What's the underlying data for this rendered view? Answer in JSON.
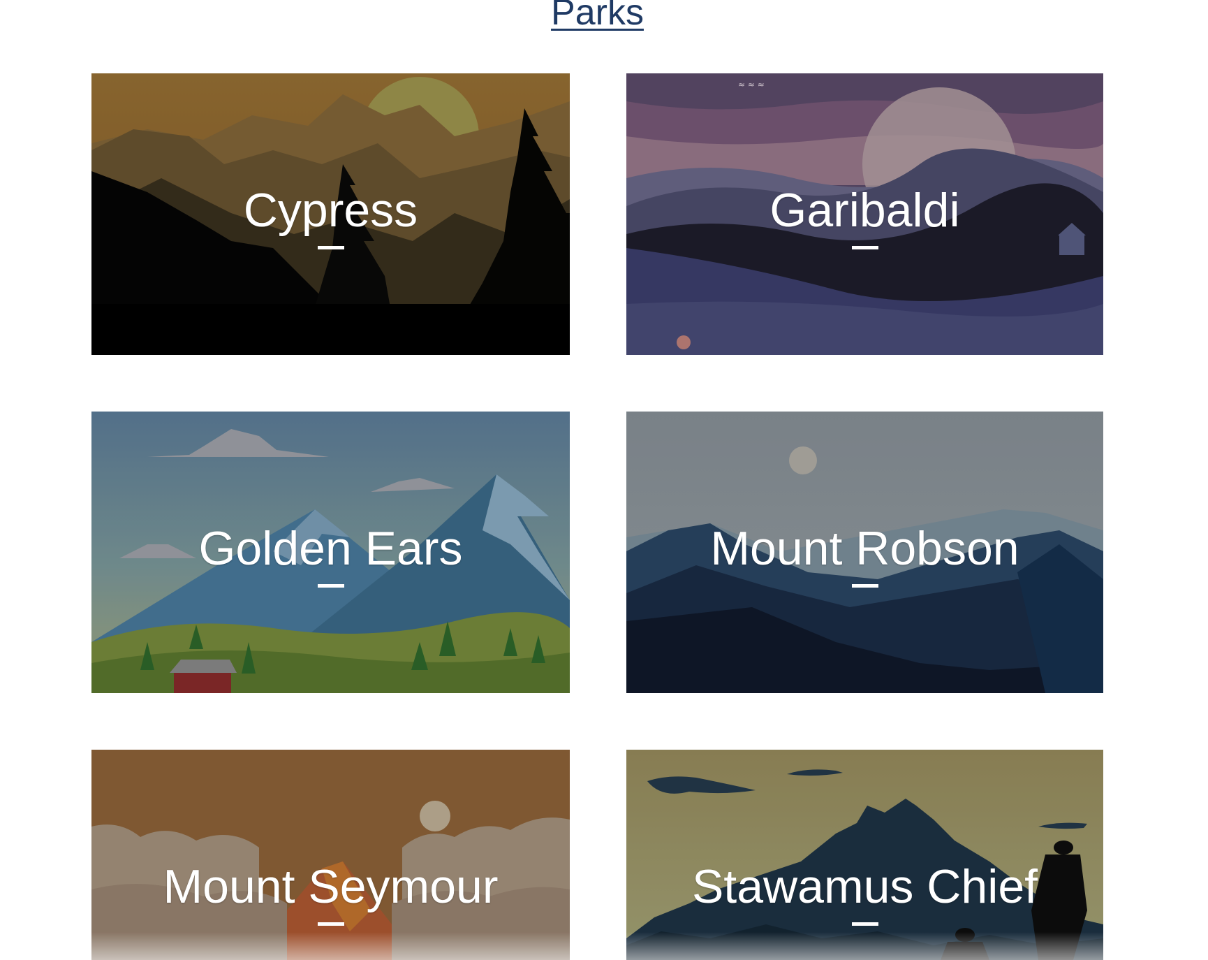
{
  "header": {
    "title": "Parks"
  },
  "parks": [
    {
      "name": "Cypress",
      "separator": "—",
      "scene": "sunset-forest-silhouette",
      "accent": "#8e6a2f"
    },
    {
      "name": "Garibaldi",
      "separator": "—",
      "scene": "purple-dusk-hills",
      "accent": "#4a4c78"
    },
    {
      "name": "Golden Ears",
      "separator": "—",
      "scene": "blue-peaks-green-valley",
      "accent": "#3d6a8a"
    },
    {
      "name": "Mount Robson",
      "separator": "—",
      "scene": "night-blue-ridges",
      "accent": "#1c2b45"
    },
    {
      "name": "Mount Seymour",
      "separator": "—",
      "scene": "orange-peak-clouds",
      "accent": "#9a6a36"
    },
    {
      "name": "Stawamus Chief",
      "separator": "—",
      "scene": "hiker-silhouette-mountain",
      "accent": "#2a3f50"
    }
  ]
}
